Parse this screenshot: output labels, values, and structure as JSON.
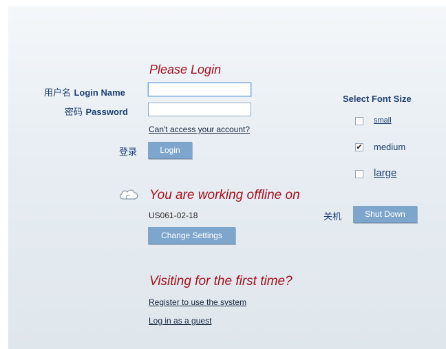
{
  "login": {
    "heading": "Please Login",
    "username_label_cn": "用户名",
    "username_label": "Login Name",
    "username_value": "",
    "password_label_cn": "密码",
    "password_label": "Password",
    "password_value": "",
    "cant_access_link": "Can't access your account?",
    "login_label_cn": "登录",
    "login_button": "Login"
  },
  "font_size": {
    "heading": "Select Font Size",
    "options": [
      {
        "label": "small",
        "checked": false
      },
      {
        "label": "medium",
        "checked": true
      },
      {
        "label": "large",
        "checked": false
      }
    ],
    "check_mark": "✔"
  },
  "offline": {
    "icon": "cloud-icon",
    "heading": "You are working offline on",
    "device_id": "US061-02-18",
    "settings_button": "Change Settings",
    "shutdown_label_cn": "关机",
    "shutdown_button": "Shut Down"
  },
  "first_time": {
    "heading": "Visiting for the first time?",
    "register_link": "Register to use the system",
    "guest_link": "Log in as a guest"
  },
  "colors": {
    "heading_red": "#a3121e",
    "label_blue": "#1e3f73",
    "button_blue": "#7ea6cc"
  }
}
